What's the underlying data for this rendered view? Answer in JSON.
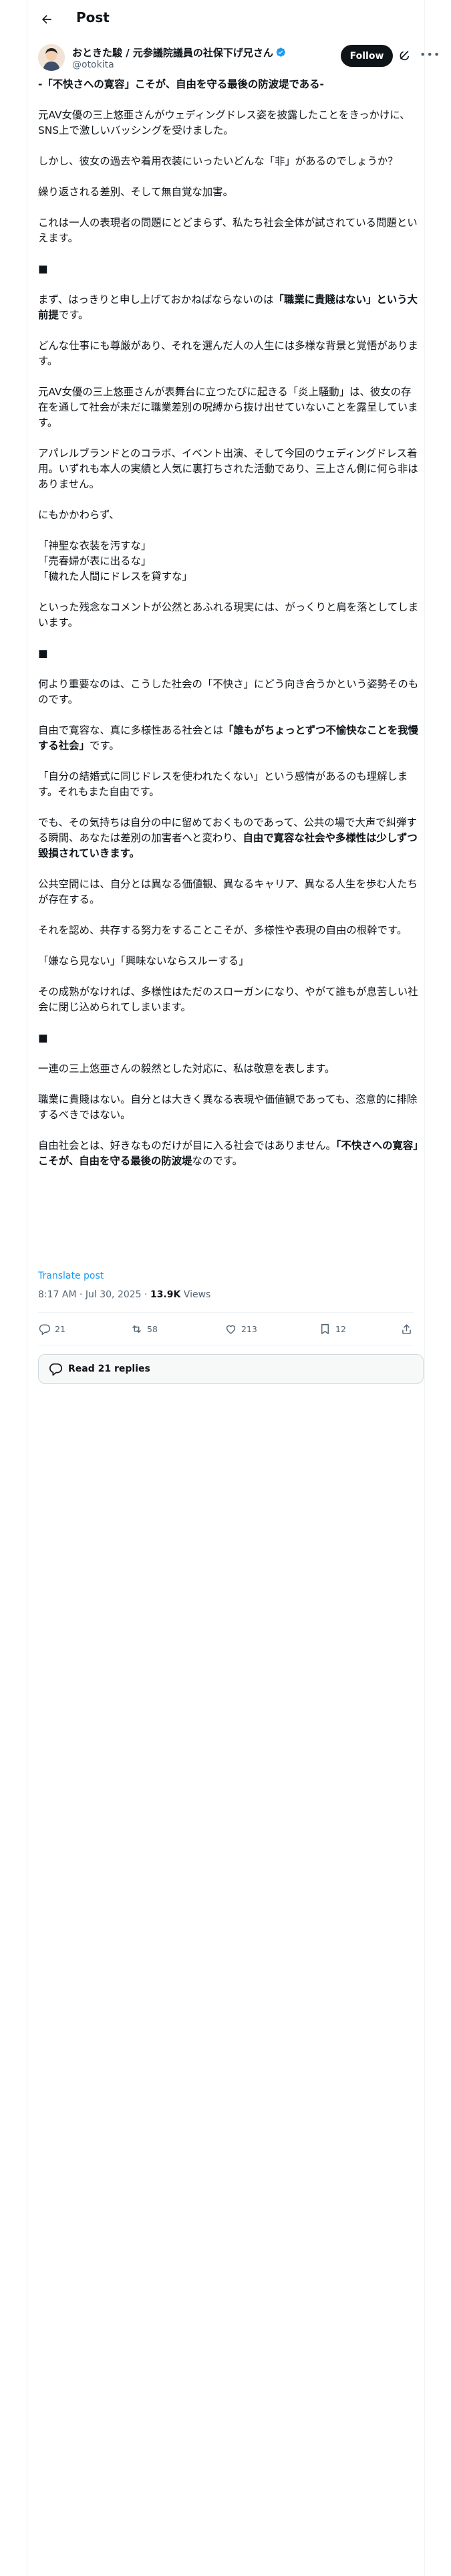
{
  "topbar": {
    "title": "Post"
  },
  "author": {
    "name": "おときた駿 / 元参議院議員の社保下げ兄さん",
    "handle": "@otokita",
    "follow_label": "Follow"
  },
  "post": {
    "paragraphs": [
      [
        {
          "t": "-「不快さへの寛容」こそが、自由を守る最後の防波堤である-",
          "b": true
        }
      ],
      [
        {
          "t": "元AV女優の三上悠亜さんがウェディングドレス姿を披露したことをきっかけに、SNS上で激しいバッシングを受けました。"
        }
      ],
      [
        {
          "t": "しかし、彼女の過去や着用衣装にいったいどんな「非」があるのでしょうか？"
        }
      ],
      [
        {
          "t": "繰り返される差別、そして無自覚な加害。"
        }
      ],
      [
        {
          "t": "これは一人の表現者の問題にとどまらず、私たち社会全体が試されている問題といえます。"
        }
      ],
      [
        {
          "t": "■",
          "b": true
        }
      ],
      [
        {
          "t": "まず、はっきりと申し上げておかねばならないのは"
        },
        {
          "t": "「職業に貴賤はない」という大前提",
          "b": true
        },
        {
          "t": "です。"
        }
      ],
      [
        {
          "t": "どんな仕事にも尊厳があり、それを選んだ人の人生には多様な背景と覚悟があります。"
        }
      ],
      [
        {
          "t": "元AV女優の三上悠亜さんが表舞台に立つたびに起きる「炎上騒動」は、彼女の存在を通して社会が未だに職業差別の呪縛から抜け出せていないことを露呈しています。"
        }
      ],
      [
        {
          "t": "アパレルブランドとのコラボ、イベント出演、そして今回のウェディングドレス着用。いずれも本人の実績と人気に裏打ちされた活動であり、三上さん側に何ら非はありません。"
        }
      ],
      [
        {
          "t": "にもかかわらず、"
        }
      ],
      [
        {
          "t": "「神聖な衣装を汚すな」"
        },
        {
          "br": true
        },
        {
          "t": "「売春婦が表に出るな」"
        },
        {
          "br": true
        },
        {
          "t": "「穢れた人間にドレスを貸すな」"
        }
      ],
      [
        {
          "t": "といった残念なコメントが公然とあふれる現実には、がっくりと肩を落としてしまいます。"
        }
      ],
      [
        {
          "t": "■",
          "b": true
        }
      ],
      [
        {
          "t": "何より重要なのは、こうした社会の「不快さ」にどう向き合うかという姿勢そのものです。"
        }
      ],
      [
        {
          "t": "自由で寛容な、真に多様性ある社会とは"
        },
        {
          "t": "「誰もがちょっとずつ不愉快なことを我慢する社会」",
          "b": true
        },
        {
          "t": "です。"
        }
      ],
      [
        {
          "t": "「自分の結婚式に同じドレスを使われたくない」という感情があるのも理解します。それもまた自由です。"
        }
      ],
      [
        {
          "t": "でも、その気持ちは自分の中に留めておくものであって、公共の場で大声で糾弾する瞬間、あなたは差別の加害者へと変わり、"
        },
        {
          "t": "自由で寛容な社会や多様性は少しずつ毀損されていきます。",
          "b": true
        }
      ],
      [
        {
          "t": "公共空間には、自分とは異なる価値観、異なるキャリア、異なる人生を歩む人たちが存在する。"
        }
      ],
      [
        {
          "t": "それを認め、共存する努力をすることこそが、多様性や表現の自由の根幹です。"
        }
      ],
      [
        {
          "t": "「嫌なら見ない」「興味ないならスルーする」"
        }
      ],
      [
        {
          "t": "その成熟がなければ、多様性はただのスローガンになり、やがて誰もが息苦しい社会に閉じ込められてしまいます。"
        }
      ],
      [
        {
          "t": "■",
          "b": true
        }
      ],
      [
        {
          "t": "一連の三上悠亜さんの毅然とした対応に、私は敬意を表します。"
        }
      ],
      [
        {
          "t": "職業に貴賤はない。自分とは大きく異なる表現や価値観であっても、恣意的に排除するべきではない。"
        }
      ],
      [
        {
          "t": "自由社会とは、好きなものだけが目に入る社会ではありません。"
        },
        {
          "t": "「不快さへの寛容」こそが、自由を守る最後の防波堤",
          "b": true
        },
        {
          "t": "なのです。"
        }
      ]
    ],
    "translate_label": "Translate post",
    "time": "8:17 AM · Jul 30, 2025",
    "separator": " · ",
    "views_count": "13.9K",
    "views_label": " Views"
  },
  "actions": {
    "replies": "21",
    "reposts": "58",
    "likes": "213",
    "bookmarks": "12"
  },
  "read_replies_label": "Read 21 replies",
  "colors": {
    "accent": "#1d9bf0",
    "text": "#0f1419",
    "muted": "#536471",
    "border": "#eff3f4"
  }
}
